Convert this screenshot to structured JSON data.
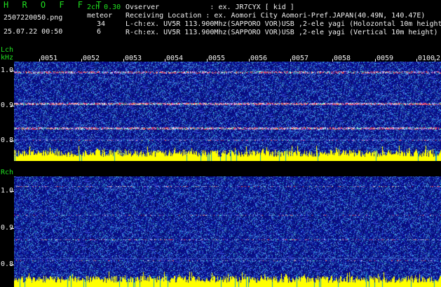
{
  "header": {
    "app_title": "H R O F F T",
    "version": "2ch 0.30",
    "mode_label": "meteor",
    "filename": "2507220050.png",
    "datetime": "25.07.22 00:50",
    "lch_count": "34",
    "rch_count": "6",
    "observer_line": "Ovserver            : ex. JR7CYX [ kid ]",
    "location_line": "Receiving Location : ex. Aomori City Aomori-Pref.JAPAN(40.49N, 140.47E)",
    "lch_line": "L-ch:ex. UV5R 113.900Mhz(SAPPORO VOR)USB ,2-ele yagi (Holozontal 10m height)",
    "rch_line": "R-ch:ex. UV5R 113.900Mhz(SAPPORO VOR)USB ,2-ele yagi (Vertical 10m height)"
  },
  "lch": {
    "label": "Lch",
    "unit": "kHz",
    "ticks": [
      "1.0",
      "0.9",
      "0.8"
    ]
  },
  "rch": {
    "label": "Rch",
    "ticks": [
      "1.0",
      "0.9",
      "0.8"
    ]
  },
  "time_labels": [
    "0051",
    "0052",
    "0053",
    "0054",
    "0055",
    "0056",
    "0057",
    "0058",
    "0059",
    "0100",
    "2"
  ],
  "colors": {
    "label_green": "#20e020",
    "text_white": "#f2f2f2",
    "spectrum_blue": "#0a1470",
    "bar_yellow": "#ffff00"
  }
}
